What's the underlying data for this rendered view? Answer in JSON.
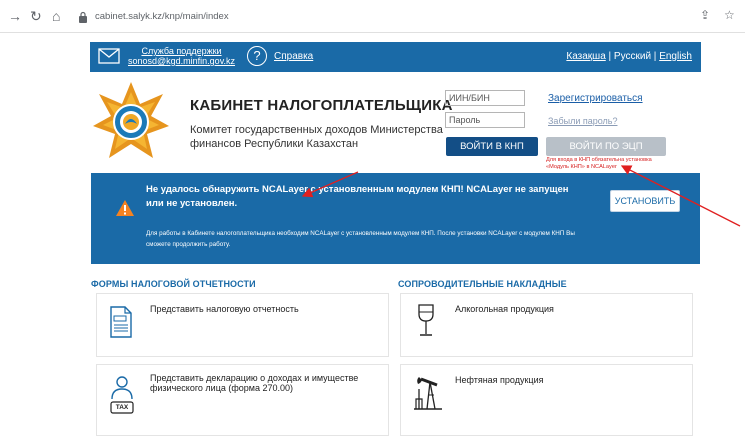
{
  "browser": {
    "url": "cabinet.salyk.kz/knp/main/index"
  },
  "topbar": {
    "support_line1": "Служба поддержки",
    "support_line2": "sonosd@kgd.minfin.gov.kz",
    "help_label": "Справка",
    "lang_kz": "Казақша",
    "lang_ru": "Русский",
    "lang_en": "English",
    "separator": " | "
  },
  "header": {
    "title": "КАБИНЕТ НАЛОГОПЛАТЕЛЬЩИКА",
    "subtitle": "Комитет государственных доходов Министерства финансов Республики Казахстан"
  },
  "login": {
    "iin_placeholder": "ИИН/БИН",
    "password_placeholder": "Пароль",
    "register_link": "Зарегистрироваться",
    "forgot_link": "Забыли пароль?",
    "login_knp_button": "ВОЙТИ В КНП",
    "login_ecp_button": "ВОЙТИ ПО ЭЦП",
    "ecp_note": "Для входа в КНП обязательна установка «Модуль КНП» в NCALayer"
  },
  "alert": {
    "title": "Не удалось обнаружить NCALayer с установленным модулем КНП! NCALayer не запущен или не установлен.",
    "text": "Для работы в Кабинете налогоплательщика необходим NCALayer с установленным модулем КНП. После установки NCALayer с модулем КНП Вы сможете продолжить работу.",
    "install_button": "УСТАНОВИТЬ",
    "accent": "#1a6aa7",
    "warning_color": "#f58220"
  },
  "sections": {
    "tax_forms": {
      "title": "ФОРМЫ НАЛОГОВОЙ ОТЧЕТНОСТИ",
      "cards": [
        {
          "label": "Представить налоговую отчетность",
          "icon": "document-icon"
        },
        {
          "label": "Представить декларацию о доходах и имуществе физического лица (форма 270.00)",
          "icon": "tax-person-icon",
          "icon_text": "TAX"
        }
      ]
    },
    "waybills": {
      "title": "СОПРОВОДИТЕЛЬНЫЕ НАКЛАДНЫЕ",
      "cards": [
        {
          "label": "Алкогольная продукция",
          "icon": "wine-glass-icon"
        },
        {
          "label": "Нефтяная продукция",
          "icon": "oil-pump-icon"
        }
      ]
    }
  }
}
